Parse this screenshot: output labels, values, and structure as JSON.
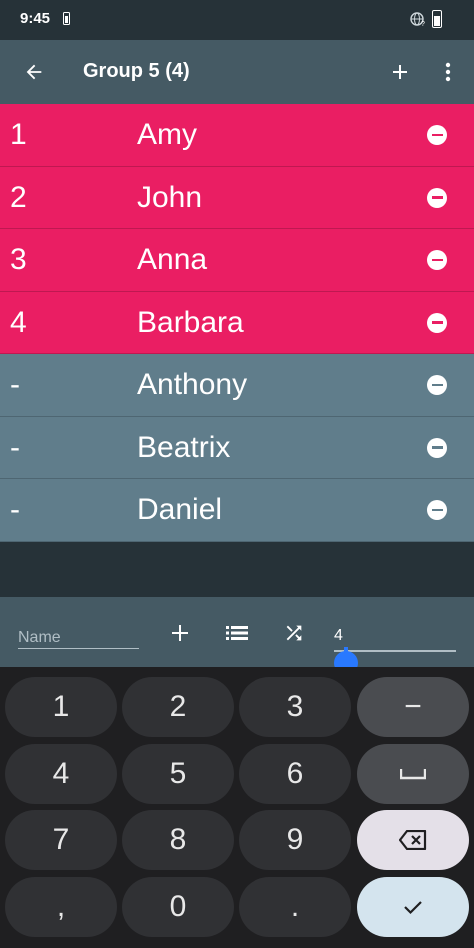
{
  "status_bar": {
    "time": "9:45"
  },
  "app_bar": {
    "title": "Group 5 (4)"
  },
  "names": [
    {
      "num": "1",
      "name": "Amy",
      "active": true
    },
    {
      "num": "2",
      "name": "John",
      "active": true
    },
    {
      "num": "3",
      "name": "Anna",
      "active": true
    },
    {
      "num": "4",
      "name": "Barbara",
      "active": true
    },
    {
      "num": "-",
      "name": "Anthony",
      "active": false
    },
    {
      "num": "-",
      "name": "Beatrix",
      "active": false
    },
    {
      "num": "-",
      "name": "Daniel",
      "active": false
    }
  ],
  "input_bar": {
    "name_placeholder": "Name",
    "name_value": "",
    "group_size": "4"
  },
  "keyboard": {
    "rows": [
      [
        "1",
        "2",
        "3",
        "−"
      ],
      [
        "4",
        "5",
        "6",
        "space"
      ],
      [
        "7",
        "8",
        "9",
        "backspace"
      ],
      [
        ",",
        "0",
        ".",
        "done"
      ]
    ]
  },
  "colors": {
    "active_row": "#ea1e63",
    "inactive_row": "#607d8b",
    "app_bar": "#455a64",
    "background": "#263238",
    "slider_accent": "#2979ff"
  }
}
